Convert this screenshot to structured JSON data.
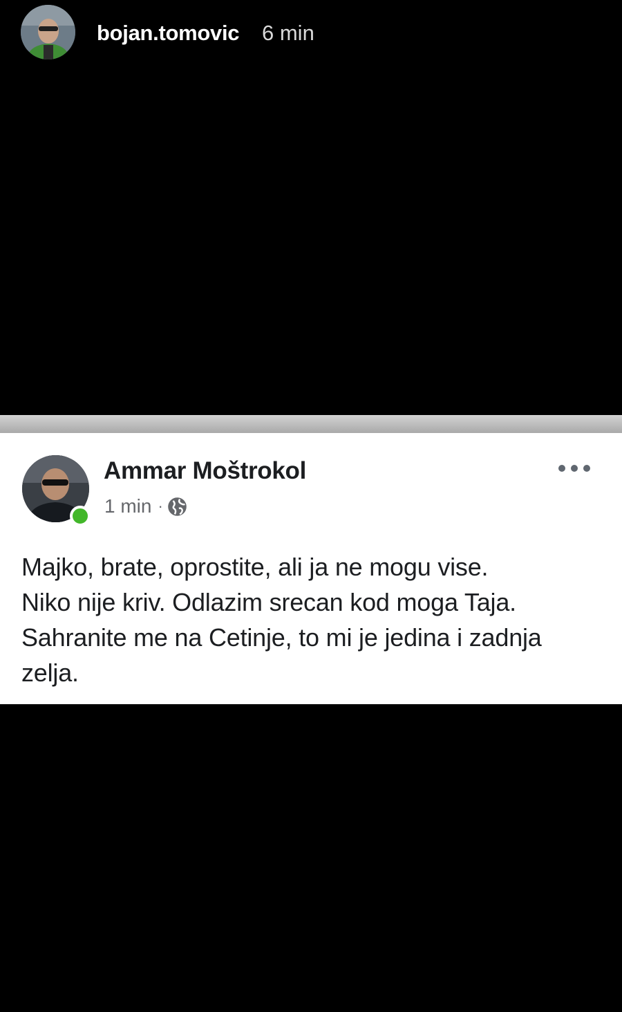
{
  "story": {
    "username": "bojan.tomovic",
    "time": "6 min"
  },
  "post": {
    "author": "Ammar Moštrokol",
    "time": "1 min",
    "separator": "·",
    "audience_icon": "globe-icon",
    "more_icon": "more-options-icon",
    "online_status_color": "#42b72a",
    "text_lines": [
      "Majko, brate, oprostite, ali ja ne mogu vise.",
      "Niko nije kriv. Odlazim srecan kod moga Taja.",
      "Sahranite me na Cetinje, to mi je jedina i zadnja",
      "zelja."
    ]
  },
  "colors": {
    "background": "#000000",
    "card": "#ffffff",
    "text": "#1c1e21",
    "meta": "#65676b"
  }
}
